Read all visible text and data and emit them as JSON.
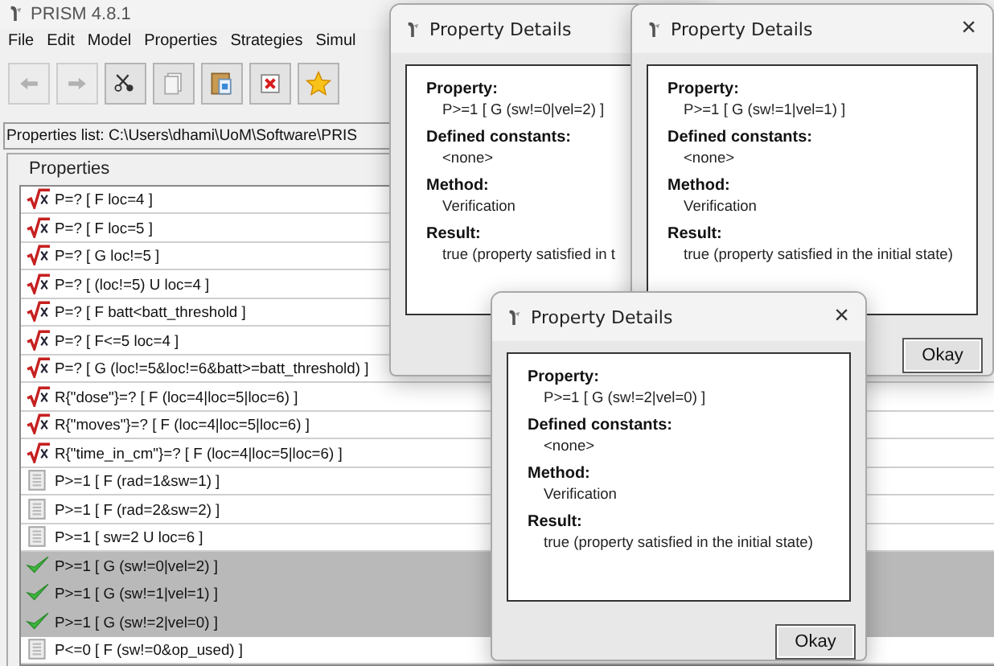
{
  "window": {
    "title": "PRISM 4.8.1"
  },
  "menu": [
    "File",
    "Edit",
    "Model",
    "Properties",
    "Strategies",
    "Simul"
  ],
  "toolbar": [
    {
      "kind": "back",
      "disabled": true
    },
    {
      "kind": "forward",
      "disabled": true
    },
    {
      "kind": "cut",
      "disabled": false
    },
    {
      "kind": "copy",
      "disabled": false
    },
    {
      "kind": "paste",
      "disabled": false
    },
    {
      "kind": "delete",
      "disabled": false
    },
    {
      "kind": "star",
      "disabled": false
    }
  ],
  "properties_list": {
    "label": "Properties list: C:\\Users\\dhami\\UoM\\Software\\PRIS"
  },
  "properties": {
    "title": "Properties",
    "rows": [
      {
        "text": "P=? [ F loc=4 ]",
        "kind": "numeric",
        "selected": false
      },
      {
        "text": "P=? [ F loc=5 ]",
        "kind": "numeric",
        "selected": false
      },
      {
        "text": "P=? [ G loc!=5 ]",
        "kind": "numeric",
        "selected": false
      },
      {
        "text": "P=? [ (loc!=5) U loc=4 ]",
        "kind": "numeric",
        "selected": false
      },
      {
        "text": "P=? [ F batt<batt_threshold ]",
        "kind": "numeric",
        "selected": false
      },
      {
        "text": "P=? [ F<=5 loc=4 ]",
        "kind": "numeric",
        "selected": false
      },
      {
        "text": "P=? [ G (loc!=5&loc!=6&batt>=batt_threshold) ]",
        "kind": "numeric",
        "selected": false
      },
      {
        "text": "R{\"dose\"}=? [ F (loc=4|loc=5|loc=6) ]",
        "kind": "numeric",
        "selected": false
      },
      {
        "text": "R{\"moves\"}=? [ F (loc=4|loc=5|loc=6) ]",
        "kind": "numeric",
        "selected": false
      },
      {
        "text": "R{\"time_in_cm\"}=? [ F (loc=4|loc=5|loc=6) ]",
        "kind": "numeric",
        "selected": false
      },
      {
        "text": "P>=1 [ F (rad=1&sw=1) ]",
        "kind": "unverified",
        "selected": false
      },
      {
        "text": "P>=1 [ F (rad=2&sw=2) ]",
        "kind": "unverified",
        "selected": false
      },
      {
        "text": "P>=1 [ sw=2 U loc=6 ]",
        "kind": "unverified",
        "selected": false
      },
      {
        "text": "P>=1 [ G (sw!=0|vel=2) ]",
        "kind": "verified",
        "selected": true
      },
      {
        "text": "P>=1 [ G (sw!=1|vel=1) ]",
        "kind": "verified",
        "selected": true
      },
      {
        "text": "P>=1 [ G (sw!=2|vel=0) ]",
        "kind": "verified",
        "selected": true
      },
      {
        "text": "P<=0 [ F (sw!=0&op_used) ]",
        "kind": "unverified",
        "selected": false
      }
    ]
  },
  "dialogs": [
    {
      "title": "Property Details",
      "sections": [
        {
          "label": "Property:",
          "value": "P>=1 [ G (sw!=0|vel=2) ]"
        },
        {
          "label": "Defined constants:",
          "value": "<none>"
        },
        {
          "label": "Method:",
          "value": "Verification"
        },
        {
          "label": "Result:",
          "value": "true (property satisfied in t"
        }
      ]
    },
    {
      "title": "Property Details",
      "close": "×",
      "sections": [
        {
          "label": "Property:",
          "value": "P>=1 [ G (sw!=1|vel=1) ]"
        },
        {
          "label": "Defined constants:",
          "value": "<none>"
        },
        {
          "label": "Method:",
          "value": "Verification"
        },
        {
          "label": "Result:",
          "value": "true (property satisfied in the initial state)"
        }
      ],
      "button": "Okay"
    },
    {
      "title": "Property Details",
      "close": "×",
      "sections": [
        {
          "label": "Property:",
          "value": "P>=1 [ G (sw!=2|vel=0) ]"
        },
        {
          "label": "Defined constants:",
          "value": "<none>"
        },
        {
          "label": "Method:",
          "value": "Verification"
        },
        {
          "label": "Result:",
          "value": "true (property satisfied in the initial state)"
        }
      ],
      "button": "Okay"
    }
  ]
}
